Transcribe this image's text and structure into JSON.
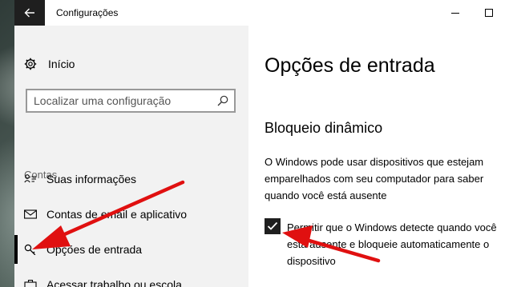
{
  "window": {
    "title": "Configurações"
  },
  "sidebar": {
    "home_label": "Início",
    "search_placeholder": "Localizar uma configuração",
    "section_label": "Contas",
    "items": [
      {
        "label": "Suas informações",
        "icon": "person-card-icon"
      },
      {
        "label": "Contas de email e aplicativo",
        "icon": "mail-icon"
      },
      {
        "label": "Opções de entrada",
        "icon": "key-icon",
        "active": true
      },
      {
        "label": "Acessar trabalho ou escola",
        "icon": "briefcase-icon"
      }
    ]
  },
  "main": {
    "heading": "Opções de entrada",
    "section_title": "Bloqueio dinâmico",
    "description": "O Windows pode usar dispositivos que estejam emparelhados com seu computador para saber quando você está ausente",
    "checkbox_label": "Permitir que o Windows detecte quando você está ausente e bloqueie automaticamente o dispositivo",
    "checkbox_checked": true
  },
  "colors": {
    "accent_dark": "#1f1f1f",
    "sidebar_bg": "#f2f2f2",
    "annotation_arrow": "#e01010"
  }
}
